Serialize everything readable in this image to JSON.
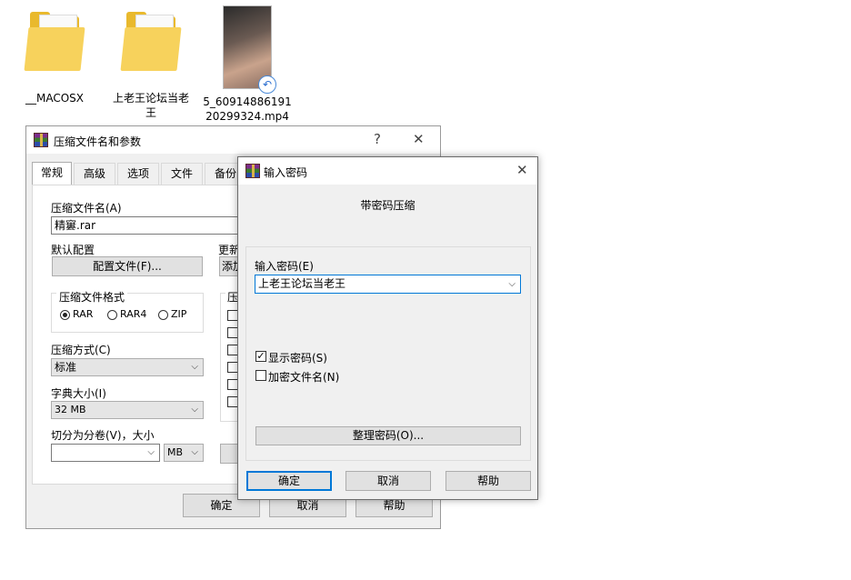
{
  "desktop": {
    "icons": [
      {
        "label": "__MACOSX"
      },
      {
        "label": "上老王论坛当老王"
      },
      {
        "label": "5_60914886191 20299324.mp4"
      }
    ]
  },
  "compress_dialog": {
    "title": "压缩文件名和参数",
    "help_glyph": "?",
    "close_glyph": "✕",
    "tabs": [
      "常规",
      "高级",
      "选项",
      "文件",
      "备份"
    ],
    "archive_name_label": "压缩文件名(A)",
    "archive_name_value": "精窶.rar",
    "default_profile_label": "默认配置",
    "profile_button": "配置文件(F)...",
    "update_label": "更新",
    "add_button": "添加",
    "format_group_label": "压缩文件格式",
    "format_options": [
      "RAR",
      "RAR4",
      "ZIP"
    ],
    "format_selected": "RAR",
    "options_group_label": "压",
    "method_label": "压缩方式(C)",
    "method_value": "标准",
    "dict_label": "字典大小(I)",
    "dict_value": "32 MB",
    "split_label": "切分为分卷(V)，大小",
    "split_value": "",
    "split_unit": "MB",
    "ok": "确定",
    "cancel": "取消",
    "help": "帮助"
  },
  "password_dialog": {
    "title": "输入密码",
    "close_glyph": "✕",
    "header": "带密码压缩",
    "password_label": "输入密码(E)",
    "password_value": "上老王论坛当老王",
    "show_password_label": "显示密码(S)",
    "show_password_checked": true,
    "encrypt_names_label": "加密文件名(N)",
    "encrypt_names_checked": false,
    "organize_button": "整理密码(O)...",
    "ok": "确定",
    "cancel": "取消",
    "help": "帮助"
  }
}
